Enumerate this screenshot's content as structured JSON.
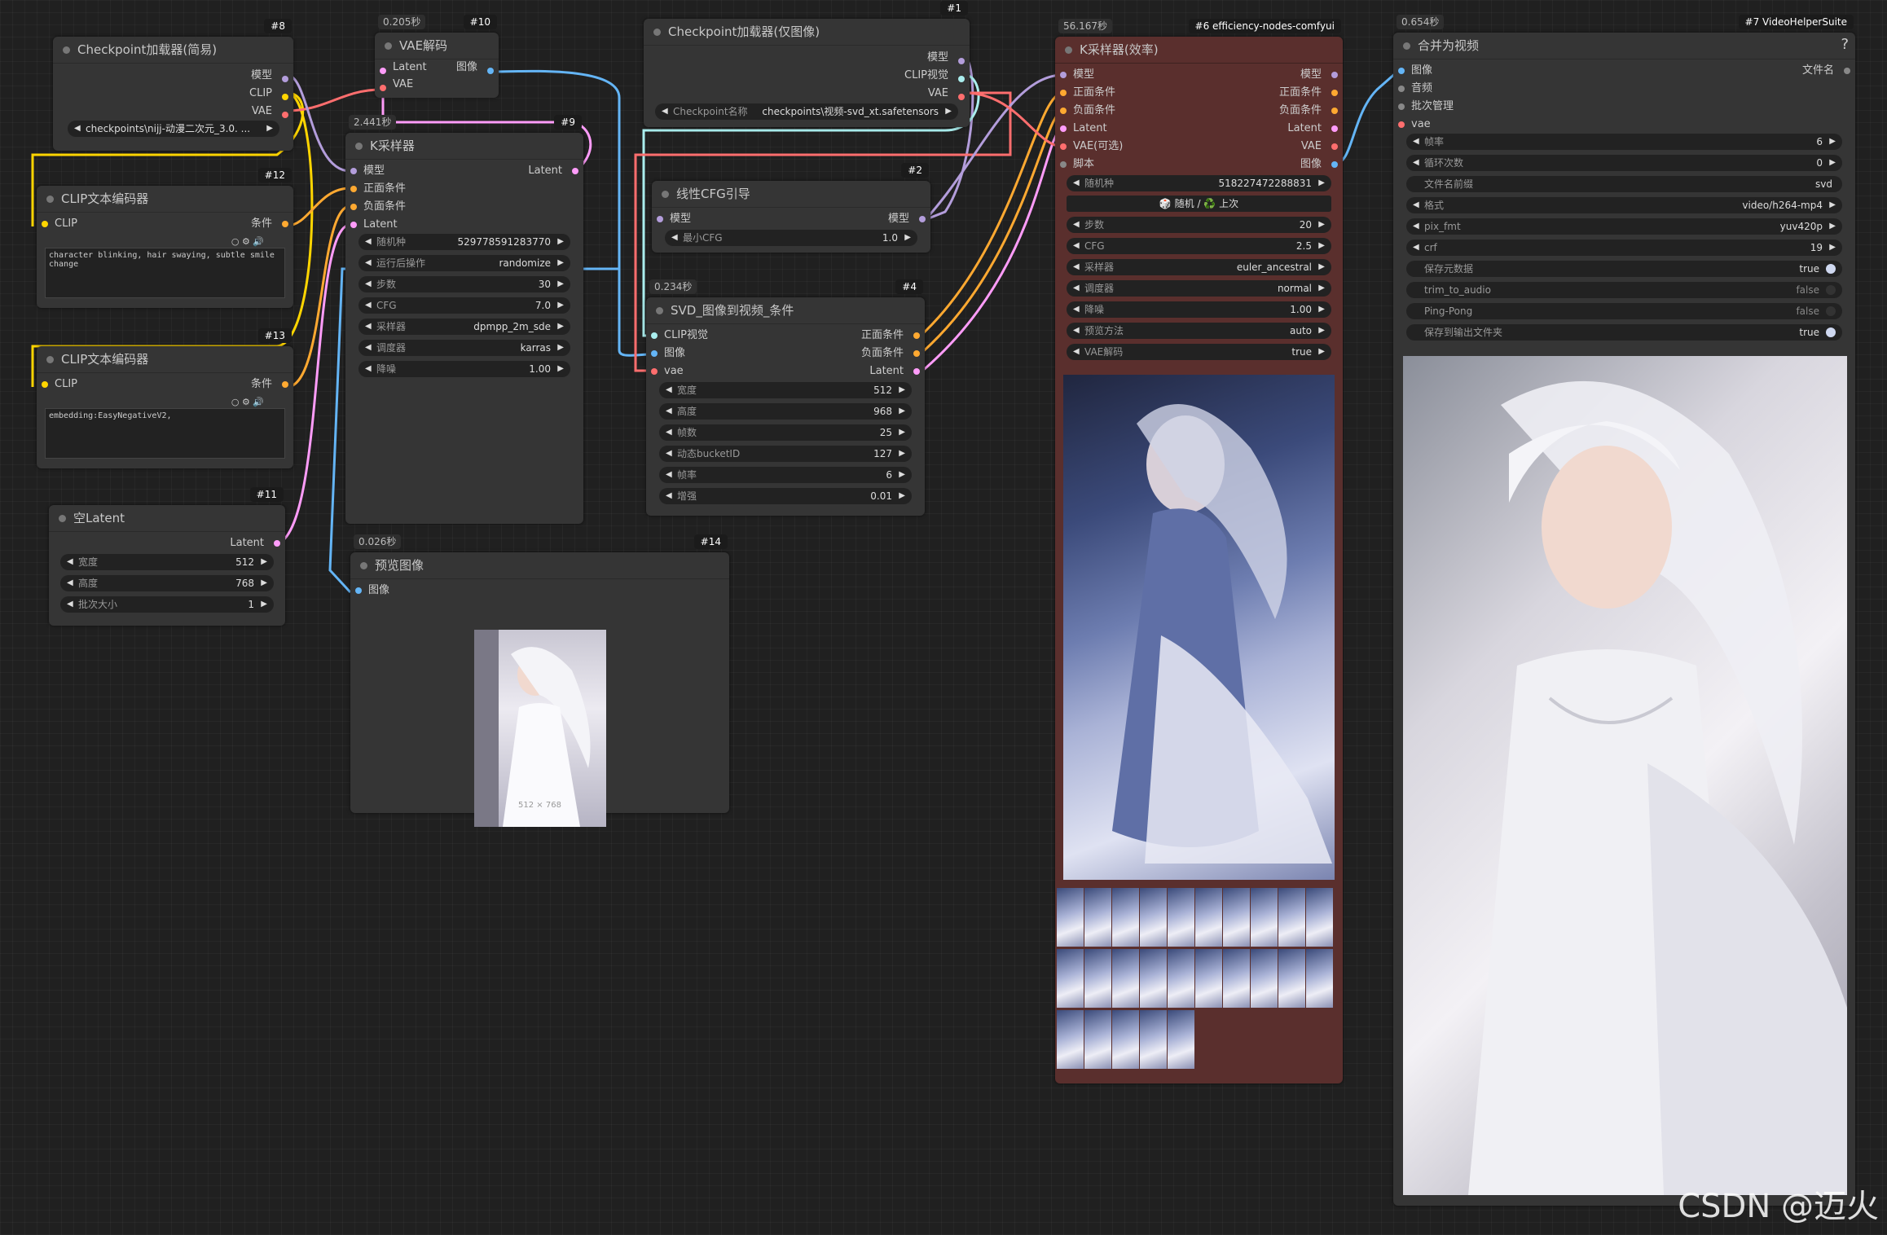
{
  "colors": {
    "model": "#b39ddb",
    "clip": "#ffd500",
    "vae": "#ff6e6e",
    "latent": "#ff9cf9",
    "image": "#64b5f6",
    "cond": "#ffa931",
    "script": "#888888"
  },
  "node8": {
    "badge": "#8",
    "title": "Checkpoint加载器(简易)",
    "out_model": "模型",
    "out_clip": "CLIP",
    "out_vae": "VAE",
    "ckpt": "checkpoints\\nijj-动漫二次元_3.0. ..."
  },
  "node10": {
    "badge": "#10",
    "time": "0.205秒",
    "title": "VAE解码",
    "in_latent": "Latent",
    "in_vae": "VAE",
    "out_image": "图像"
  },
  "node1": {
    "badge": "#1",
    "title": "Checkpoint加载器(仅图像)",
    "out_model": "模型",
    "out_clip_vision": "CLIP视觉",
    "out_vae": "VAE",
    "ckpt_label": "Checkpoint名称",
    "ckpt": "checkpoints\\视频-svd_xt.safetensors"
  },
  "node6": {
    "badge": "#6 efficiency-nodes-comfyui",
    "time": "56.167秒",
    "title": "K采样器(效率)",
    "in_model": "模型",
    "in_pos": "正面条件",
    "in_neg": "负面条件",
    "in_latent": "Latent",
    "in_vae": "VAE(可选)",
    "in_script": "脚本",
    "out_model": "模型",
    "out_pos": "正面条件",
    "out_neg": "负面条件",
    "out_latent": "Latent",
    "out_vae": "VAE",
    "out_image": "图像",
    "seed_label": "随机种",
    "seed": "518227472288831",
    "seed_btn": "🎲 随机 / ♻️ 上次",
    "steps_label": "步数",
    "steps": "20",
    "cfg_label": "CFG",
    "cfg": "2.5",
    "sampler_label": "采样器",
    "sampler": "euler_ancestral",
    "sched_label": "调度器",
    "sched": "normal",
    "denoise_label": "降噪",
    "denoise": "1.00",
    "preview_label": "预览方法",
    "preview": "auto",
    "vaedec_label": "VAE解码",
    "vaedec": "true"
  },
  "node7": {
    "badge": "#7 VideoHelperSuite",
    "time": "0.654秒",
    "title": "合并为视频",
    "help": "?",
    "in_image": "图像",
    "in_audio": "音频",
    "in_batch": "批次管理",
    "in_vae": "vae",
    "out_filename": "文件名",
    "w": [
      {
        "l": "帧率",
        "v": "6"
      },
      {
        "l": "循环次数",
        "v": "0"
      },
      {
        "l": "文件名前缀",
        "v": "svd"
      },
      {
        "l": "格式",
        "v": "video/h264-mp4"
      },
      {
        "l": "pix_fmt",
        "v": "yuv420p"
      },
      {
        "l": "crf",
        "v": "19"
      }
    ],
    "t": [
      {
        "l": "保存元数据",
        "v": "true"
      },
      {
        "l": "trim_to_audio",
        "v": "false"
      },
      {
        "l": "Ping-Pong",
        "v": "false"
      },
      {
        "l": "保存到输出文件夹",
        "v": "true"
      }
    ]
  },
  "node9": {
    "badge": "#9",
    "time": "2.441秒",
    "title": "K采样器",
    "in_model": "模型",
    "in_pos": "正面条件",
    "in_neg": "负面条件",
    "in_latent": "Latent",
    "out_latent": "Latent",
    "w": [
      {
        "l": "随机种",
        "v": "529778591283770"
      },
      {
        "l": "运行后操作",
        "v": "randomize"
      },
      {
        "l": "步数",
        "v": "30"
      },
      {
        "l": "CFG",
        "v": "7.0"
      },
      {
        "l": "采样器",
        "v": "dpmpp_2m_sde"
      },
      {
        "l": "调度器",
        "v": "karras"
      },
      {
        "l": "降噪",
        "v": "1.00"
      }
    ]
  },
  "node2": {
    "badge": "#2",
    "title": "线性CFG引导",
    "in_model": "模型",
    "out_model": "模型",
    "mincfg_label": "最小CFG",
    "mincfg": "1.0"
  },
  "node4": {
    "badge": "#4",
    "time": "0.234秒",
    "title": "SVD_图像到视频_条件",
    "in_clip_vision": "CLIP视觉",
    "in_image": "图像",
    "in_vae": "vae",
    "out_pos": "正面条件",
    "out_neg": "负面条件",
    "out_latent": "Latent",
    "w": [
      {
        "l": "宽度",
        "v": "512"
      },
      {
        "l": "高度",
        "v": "968"
      },
      {
        "l": "帧数",
        "v": "25"
      },
      {
        "l": "动态bucketID",
        "v": "127"
      },
      {
        "l": "帧率",
        "v": "6"
      },
      {
        "l": "增强",
        "v": "0.01"
      }
    ]
  },
  "node12": {
    "badge": "#12",
    "title": "CLIP文本编码器",
    "in_clip": "CLIP",
    "out_cond": "条件",
    "text": "character blinking, hair swaying, subtle smile change"
  },
  "node13": {
    "badge": "#13",
    "title": "CLIP文本编码器",
    "in_clip": "CLIP",
    "out_cond": "条件",
    "text": "embedding:EasyNegativeV2,"
  },
  "node11": {
    "badge": "#11",
    "title": "空Latent",
    "out_latent": "Latent",
    "w": [
      {
        "l": "宽度",
        "v": "512"
      },
      {
        "l": "高度",
        "v": "768"
      },
      {
        "l": "批次大小",
        "v": "1"
      }
    ]
  },
  "node14": {
    "badge": "#14",
    "time": "0.026秒",
    "title": "预览图像",
    "in_image": "图像",
    "size": "512 × 768"
  },
  "watermark": "CSDN @迈火"
}
